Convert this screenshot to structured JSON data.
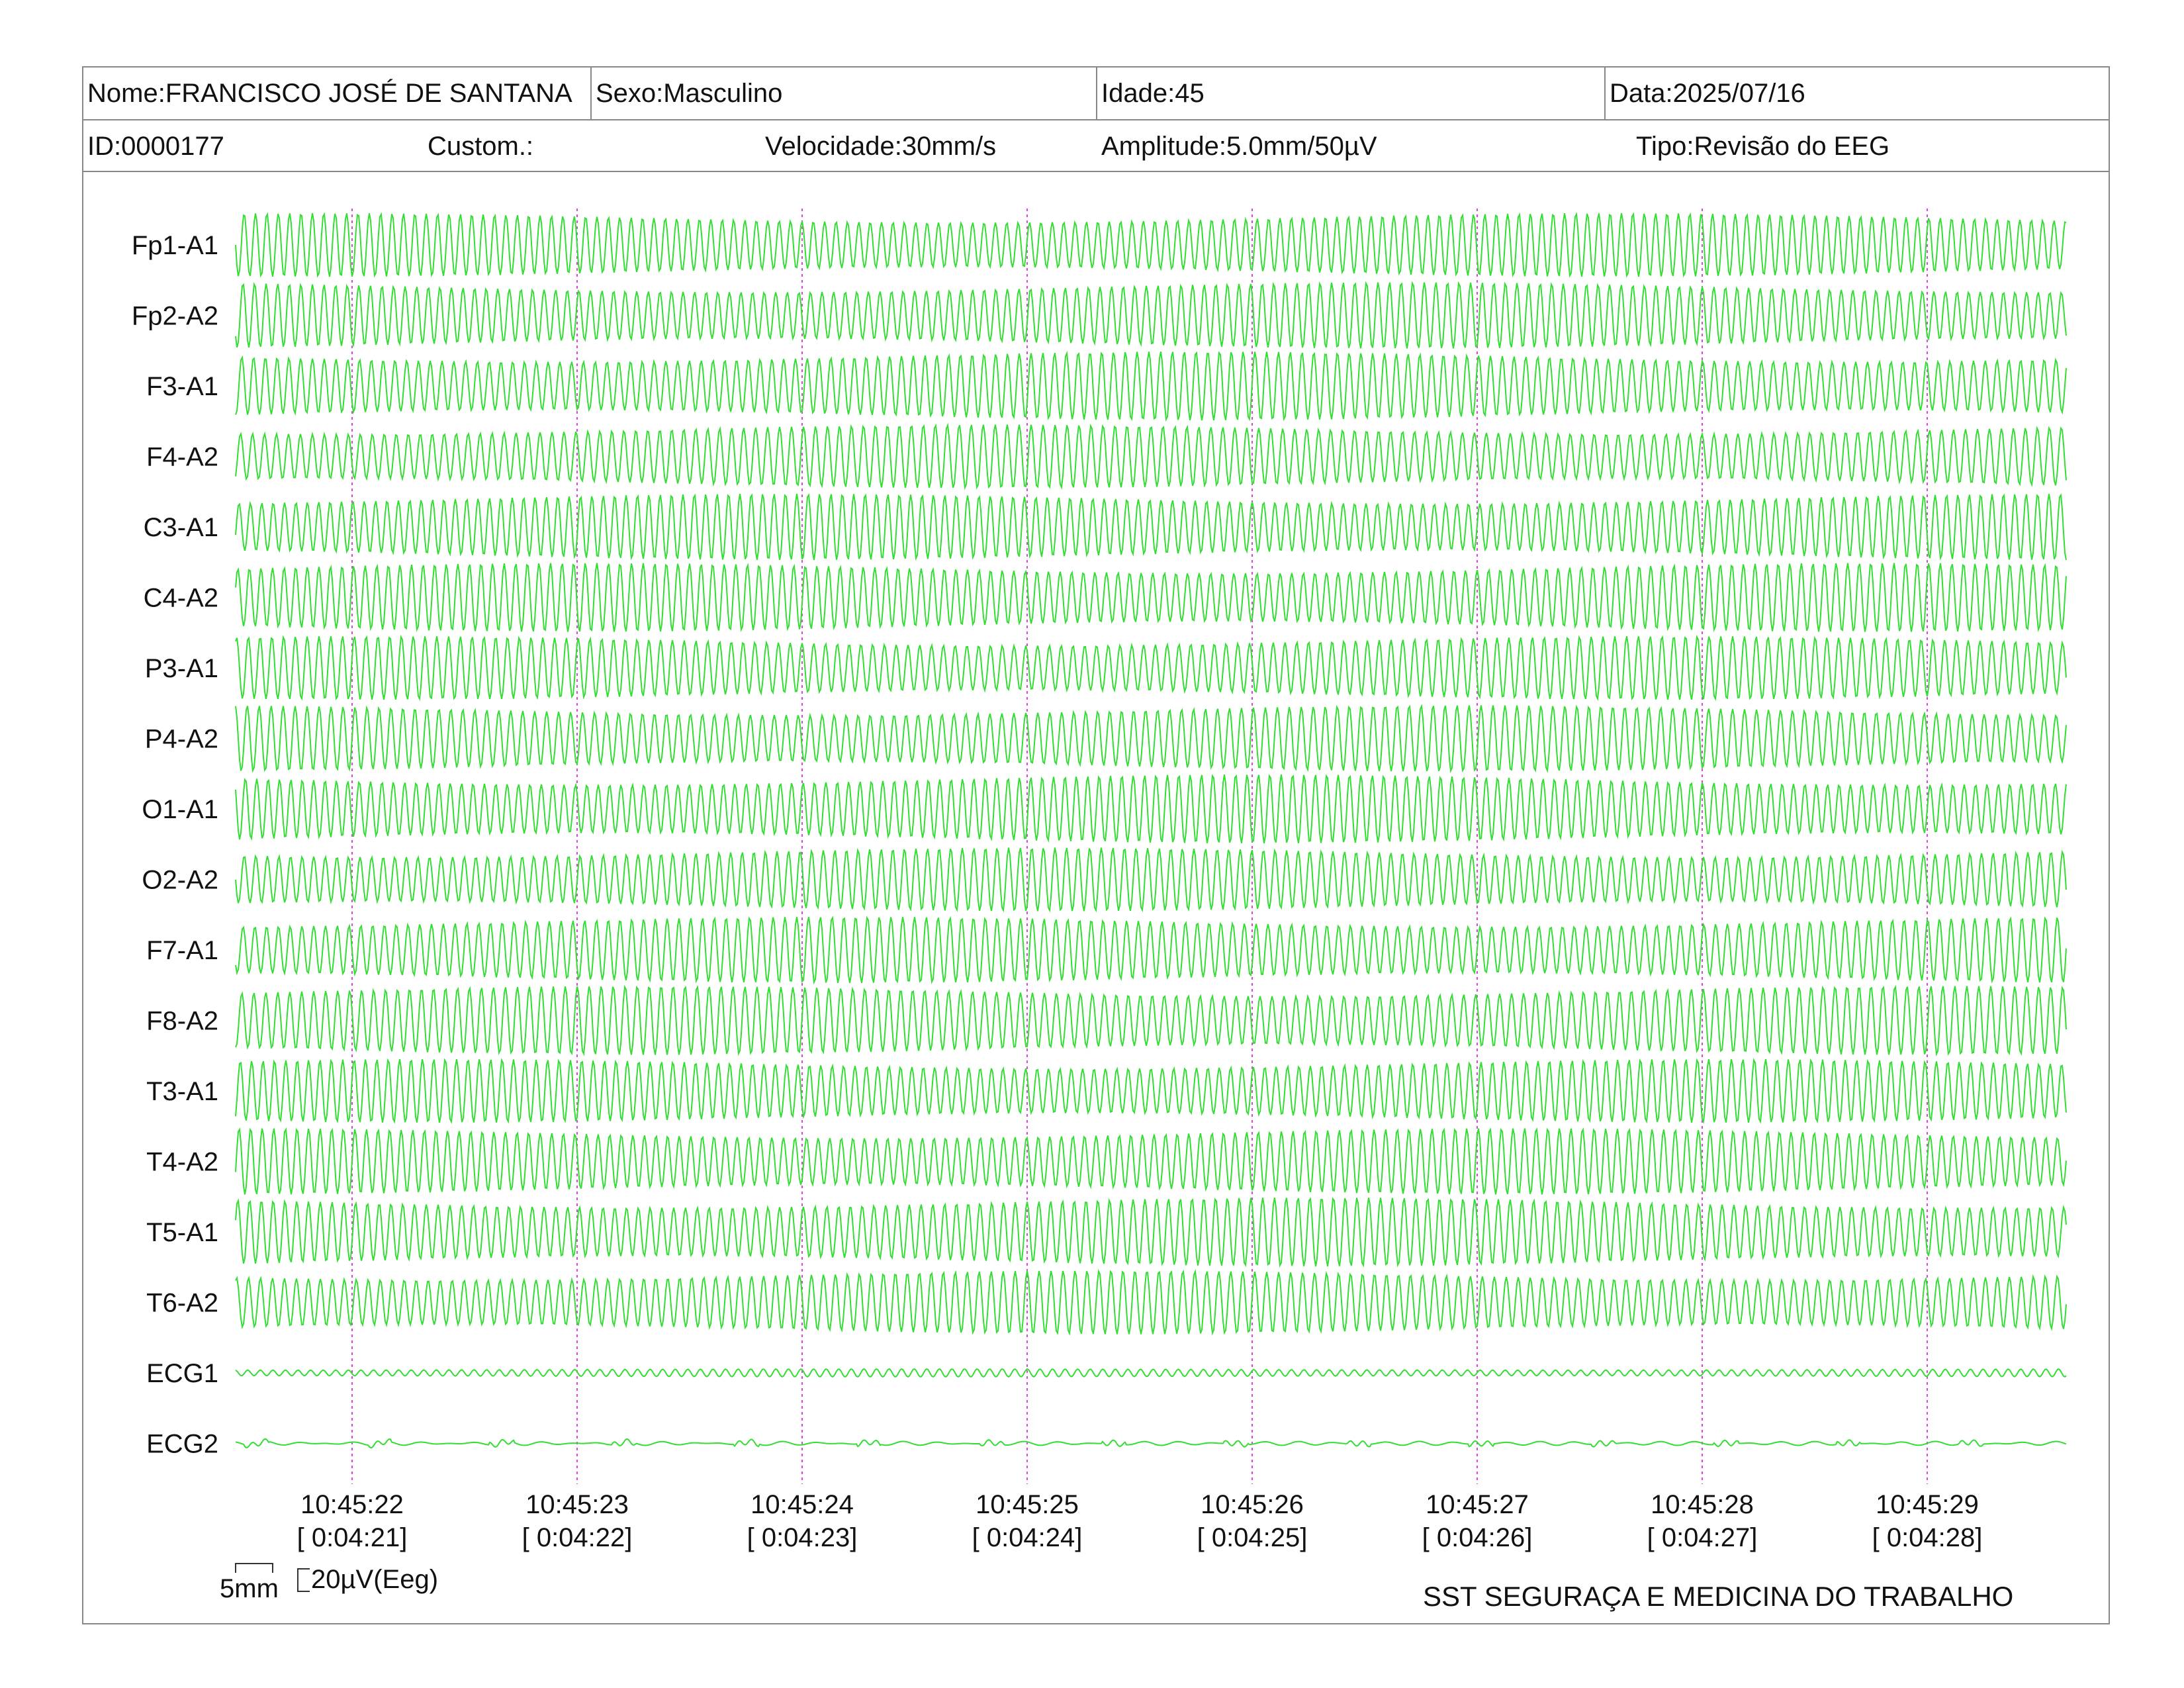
{
  "header": {
    "row1": {
      "nome": "Nome:FRANCISCO JOSÉ DE SANTANA",
      "sexo": "Sexo:Masculino",
      "idade": "Idade:45",
      "data": "Data:2025/07/16"
    },
    "row2": {
      "id": "ID:0000177",
      "custom": "Custom.:",
      "velocidade": "Velocidade:30mm/s",
      "amplitude": "Amplitude:5.0mm/50µV",
      "tipo": "Tipo:Revisão do EEG"
    }
  },
  "calibration": {
    "time_label": "5mm",
    "amp_label": "20µV(Eeg)"
  },
  "footer": {
    "company": "SST SEGURAÇA E MEDICINA DO TRABALHO"
  },
  "colors": {
    "trace": "#33dd33",
    "marker": "#dd44dd",
    "border": "#888888"
  },
  "chart_data": {
    "type": "line",
    "channels": [
      "Fp1-A1",
      "Fp2-A2",
      "F3-A1",
      "F4-A2",
      "C3-A1",
      "C4-A2",
      "P3-A1",
      "P4-A2",
      "O1-A1",
      "O2-A2",
      "F7-A1",
      "F8-A2",
      "T3-A1",
      "T4-A2",
      "T5-A1",
      "T6-A2",
      "ECG1",
      "ECG2"
    ],
    "time_markers": [
      {
        "clock": "10:45:22",
        "elapsed": "[ 0:04:21]"
      },
      {
        "clock": "10:45:23",
        "elapsed": "[ 0:04:22]"
      },
      {
        "clock": "10:45:24",
        "elapsed": "[ 0:04:23]"
      },
      {
        "clock": "10:45:25",
        "elapsed": "[ 0:04:24]"
      },
      {
        "clock": "10:45:26",
        "elapsed": "[ 0:04:25]"
      },
      {
        "clock": "10:45:27",
        "elapsed": "[ 0:04:26]"
      },
      {
        "clock": "10:45:28",
        "elapsed": "[ 0:04:27]"
      },
      {
        "clock": "10:45:29",
        "elapsed": "[ 0:04:28]"
      }
    ],
    "xlabel": "",
    "ylabel": "",
    "grid": false
  }
}
